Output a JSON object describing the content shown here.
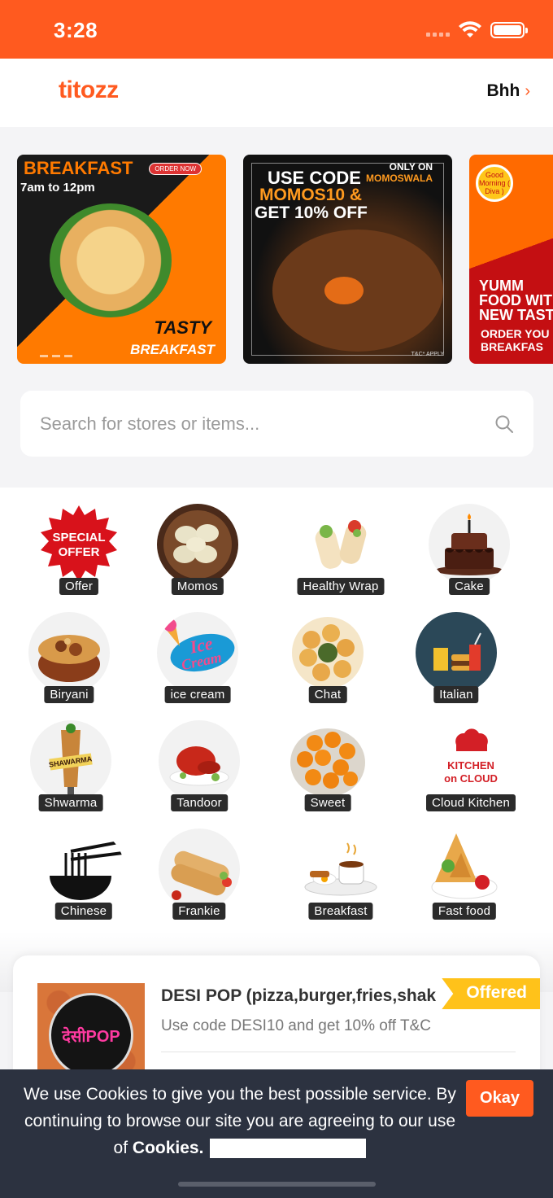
{
  "status_bar": {
    "time": "3:28"
  },
  "header": {
    "logo": "titozz",
    "location": "Bhh",
    "chevron": "›"
  },
  "banners": [
    {
      "title": "BREAKFAST",
      "hours": "7am to 12pm",
      "cta": "ORDER NOW",
      "tag1": "TASTY",
      "tag2": "BREAKFAST"
    },
    {
      "line1": "USE CODE",
      "code": "MOMOS10 &",
      "line3": "GET 10% OFF",
      "only_on": "ONLY ON",
      "brand": "MOMOSWALA",
      "tc": "T&C* APPLY"
    },
    {
      "badge": "Good Morning ( Diva )",
      "headline": "YUMM\nFOOD WIT\nNEW TAST",
      "cta": "ORDER YOU\nBREAKFAS"
    }
  ],
  "search": {
    "placeholder": "Search for stores or items..."
  },
  "categories": [
    {
      "label": "Offer",
      "icon": "special-offer-icon"
    },
    {
      "label": "Momos",
      "icon": "momos-icon"
    },
    {
      "label": "Healthy Wrap",
      "icon": "wrap-icon"
    },
    {
      "label": "Cake",
      "icon": "cake-icon"
    },
    {
      "label": "Biryani",
      "icon": "biryani-icon"
    },
    {
      "label": "ice cream",
      "icon": "ice-cream-icon"
    },
    {
      "label": "Chat",
      "icon": "chat-icon"
    },
    {
      "label": "Italian",
      "icon": "italian-icon"
    },
    {
      "label": "Shwarma",
      "icon": "shawarma-icon"
    },
    {
      "label": "Tandoor",
      "icon": "tandoor-icon"
    },
    {
      "label": "Sweet",
      "icon": "sweet-icon"
    },
    {
      "label": "Cloud Kitchen",
      "icon": "cloud-kitchen-icon"
    },
    {
      "label": "Chinese",
      "icon": "noodles-icon"
    },
    {
      "label": "Frankie",
      "icon": "frankie-icon"
    },
    {
      "label": "Breakfast",
      "icon": "breakfast-icon"
    },
    {
      "label": "Fast food",
      "icon": "fast-food-icon"
    }
  ],
  "category_art": {
    "offer_badge": "SPECIAL\nOFFER",
    "icecream_logo": "Ice Cream",
    "shawarma_sign": "SHAWARMA",
    "cloud_kitchen_logo": "KITCHEN\nON CLOUD"
  },
  "store": {
    "name": "DESI POP (pizza,burger,fries,shak",
    "description": "Use code DESI10 and get 10% off T&C",
    "ribbon": "Offered",
    "logo_text": "देसीPOP"
  },
  "cookie": {
    "text": "We use Cookies to give you the best possible service. By continuing to browse our site you are agreeing to our use of",
    "bold": "Cookies.",
    "button": "Okay"
  },
  "colors": {
    "brand": "#ff5a1f",
    "ribbon": "#ffc21a",
    "cookie_bg": "#2c3240"
  }
}
